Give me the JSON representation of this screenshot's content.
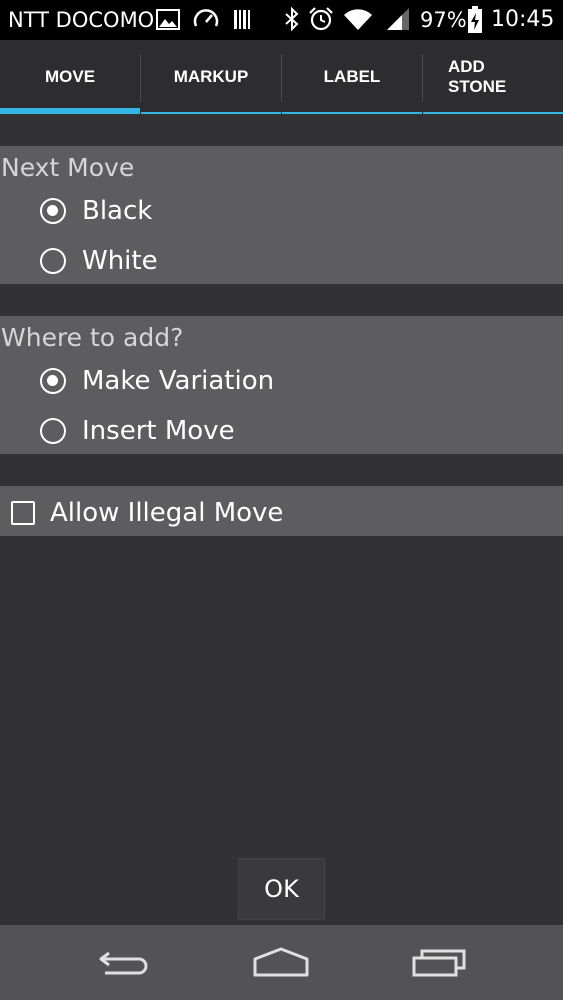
{
  "status_bar": {
    "carrier": "NTT DOCOMO",
    "battery": "97%",
    "time": "10:45",
    "icons": [
      "image-icon",
      "speedometer-icon",
      "barcode-icon",
      "bluetooth-icon",
      "alarm-icon",
      "wifi-icon",
      "signal-icon",
      "battery-charging-icon"
    ]
  },
  "tabs": [
    {
      "label": "MOVE",
      "selected": true
    },
    {
      "label": "MARKUP",
      "selected": false
    },
    {
      "label": "LABEL",
      "selected": false
    },
    {
      "label_line1": "ADD",
      "label_line2": "STONE",
      "selected": false
    }
  ],
  "next_move": {
    "title": "Next Move",
    "options": [
      {
        "label": "Black",
        "checked": true
      },
      {
        "label": "White",
        "checked": false
      }
    ]
  },
  "where_to_add": {
    "title": "Where to add?",
    "options": [
      {
        "label": "Make Variation",
        "checked": true
      },
      {
        "label": "Insert Move",
        "checked": false
      }
    ]
  },
  "allow_illegal": {
    "label": "Allow Illegal Move",
    "checked": false
  },
  "ok_button": "OK",
  "nav": [
    "back-icon",
    "home-icon",
    "recent-apps-icon"
  ],
  "colors": {
    "accent": "#33b5e5",
    "background": "#323133",
    "section": "#5d5d5f",
    "navbar": "#535355"
  }
}
